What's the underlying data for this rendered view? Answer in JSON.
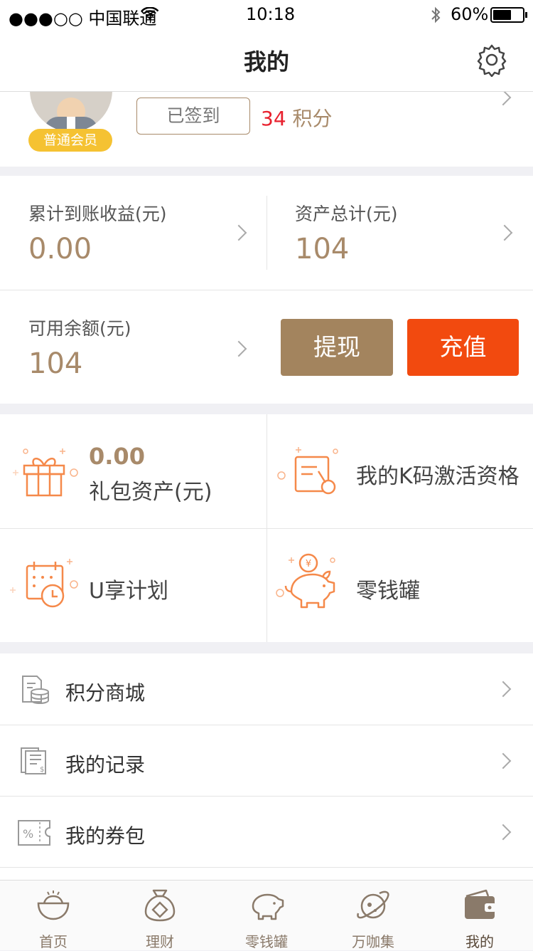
{
  "status": {
    "carrier": "●●●○○ 中国联通",
    "time": "10:18",
    "battery": "60%"
  },
  "nav": {
    "title": "我的"
  },
  "profile": {
    "level": "普通会员",
    "sign_btn": "已签到",
    "points_num": "34",
    "points_unit": "积分"
  },
  "stats": {
    "earn_label": "累计到账收益(元)",
    "earn_value": "0.00",
    "asset_label": "资产总计(元)",
    "asset_value": "104",
    "balance_label": "可用余额(元)",
    "balance_value": "104",
    "withdraw": "提现",
    "recharge": "充值"
  },
  "grid": {
    "gift_value": "0.00",
    "gift_label": "礼包资产(元)",
    "kcode": "我的K码激活资格",
    "uplan": "U享计划",
    "piggy": "零钱罐"
  },
  "list": [
    {
      "label": "积分商城",
      "icon": "coins-icon"
    },
    {
      "label": "我的记录",
      "icon": "record-icon"
    },
    {
      "label": "我的券包",
      "icon": "coupon-icon"
    }
  ],
  "tabs": [
    {
      "label": "首页",
      "icon": "ingot-icon"
    },
    {
      "label": "理财",
      "icon": "moneybag-icon"
    },
    {
      "label": "零钱罐",
      "icon": "piggy-icon"
    },
    {
      "label": "万咖集",
      "icon": "planet-icon"
    },
    {
      "label": "我的",
      "icon": "wallet-icon"
    }
  ],
  "colors": {
    "accent": "#a88a6a",
    "recharge": "#f24a0f",
    "withdraw": "#a3845e",
    "icon_orange": "#f5894a",
    "badge": "#f5c232"
  }
}
